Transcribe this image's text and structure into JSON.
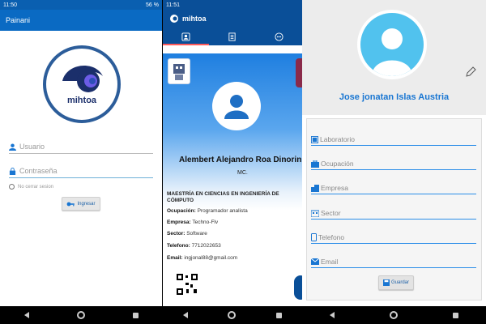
{
  "screen1": {
    "status": {
      "time": "11:50",
      "battery": "56 %"
    },
    "appbar_title": "Painani",
    "logo_text": "mihtoa",
    "username_placeholder": "Usuario",
    "password_placeholder": "Contraseña",
    "remember_label": "No cerrar sesion",
    "login_button": "Ingresar"
  },
  "screen2": {
    "status": {
      "time": "11:51"
    },
    "app_title": "mihtoa",
    "tabs": [
      {
        "icon": "id-card-icon"
      },
      {
        "icon": "document-icon"
      },
      {
        "icon": "chat-icon"
      }
    ],
    "profile": {
      "name": "Alembert Alejandro Roa Dinorin",
      "title": "MC.",
      "degree": "MAESTRÍA EN CIENCIAS EN INGENIERÍA DE CÓMPUTO",
      "fields": [
        {
          "label": "Ocupación:",
          "value": "Programador analista"
        },
        {
          "label": "Empresa:",
          "value": "Techno-Flv"
        },
        {
          "label": "Sector:",
          "value": "Software"
        },
        {
          "label": "Telefono:",
          "value": "7712022653"
        },
        {
          "label": "Email:",
          "value": "ingjonal88@gmail.com"
        }
      ]
    }
  },
  "screen3": {
    "user_name": "Jose jonatan Islas Austria",
    "fields": [
      {
        "label": "Laboratorio"
      },
      {
        "label": "Ocupación"
      },
      {
        "label": "Empresa"
      },
      {
        "label": "Sector"
      },
      {
        "label": "Telefono"
      },
      {
        "label": "Email"
      }
    ],
    "save_button": "Guardar"
  },
  "colors": {
    "primary": "#0a6ac3",
    "accent": "#1976d2",
    "avatar_bg": "#51c2ee"
  }
}
